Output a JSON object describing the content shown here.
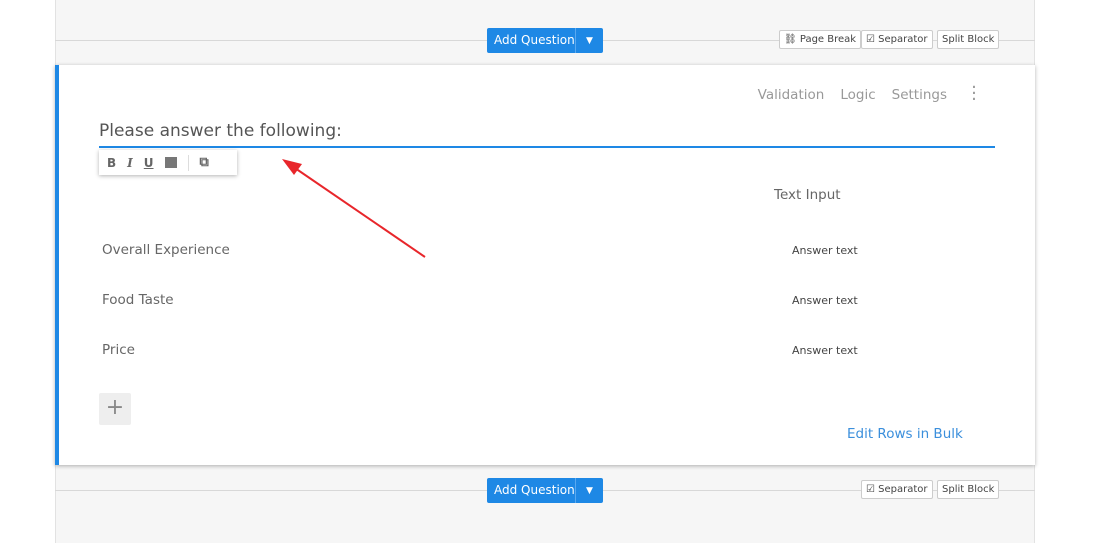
{
  "top_bar": {
    "add_question": "Add Question",
    "page_break": "Page Break",
    "separator": "Separator",
    "split_block": "Split Block"
  },
  "question": {
    "tools": [
      "Validation",
      "Logic",
      "Settings"
    ],
    "title": "Please answer the following:",
    "toolbar": [
      "B",
      "I",
      "U"
    ],
    "column_header": "Text Input",
    "rows": [
      {
        "label": "Overall Experience",
        "answer": "Answer text"
      },
      {
        "label": "Food Taste",
        "answer": "Answer text"
      },
      {
        "label": "Price",
        "answer": "Answer text"
      }
    ],
    "add_row": "+",
    "edit_bulk": "Edit Rows in Bulk"
  },
  "bottom_bar": {
    "add_question": "Add Question",
    "separator": "Separator",
    "split_block": "Split Block"
  },
  "colors": {
    "accent": "#1e88e5",
    "arrow": "#e8262b"
  }
}
